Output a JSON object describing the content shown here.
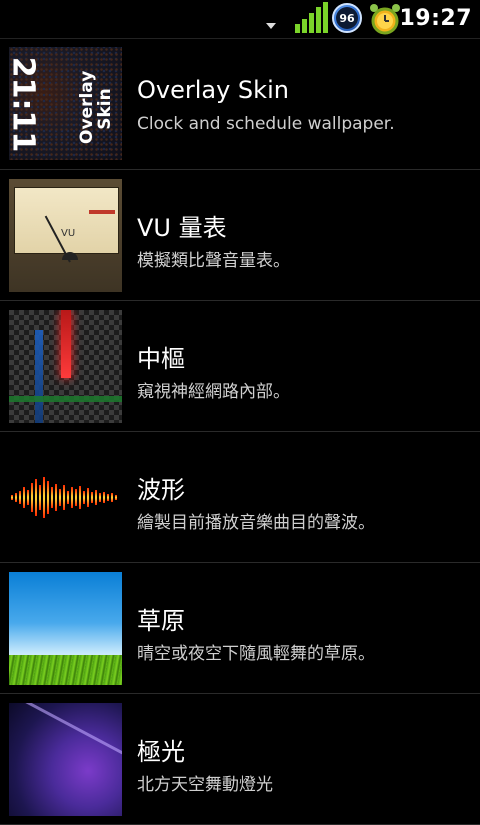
{
  "status_bar": {
    "battery_level": "96",
    "time": "19:27",
    "icons": [
      "download-icon",
      "signal-icon",
      "battery-icon",
      "alarm-icon"
    ]
  },
  "wallpapers": [
    {
      "title": "Overlay Skin",
      "subtitle": "Clock and schedule wallpaper.",
      "thumb": {
        "clock_text": "21:11",
        "label_line1": "Overlay",
        "label_line2": "Skin"
      }
    },
    {
      "title": "VU 量表",
      "subtitle": "模擬類比聲音量表。",
      "thumb": {
        "meter_label": "VU"
      }
    },
    {
      "title": "中樞",
      "subtitle": "窺視神經網路內部。"
    },
    {
      "title": "波形",
      "subtitle": "繪製目前播放音樂曲目的聲波。"
    },
    {
      "title": "草原",
      "subtitle": "晴空或夜空下隨風輕舞的草原。"
    },
    {
      "title": "極光",
      "subtitle": "北方天空舞動燈光"
    }
  ]
}
